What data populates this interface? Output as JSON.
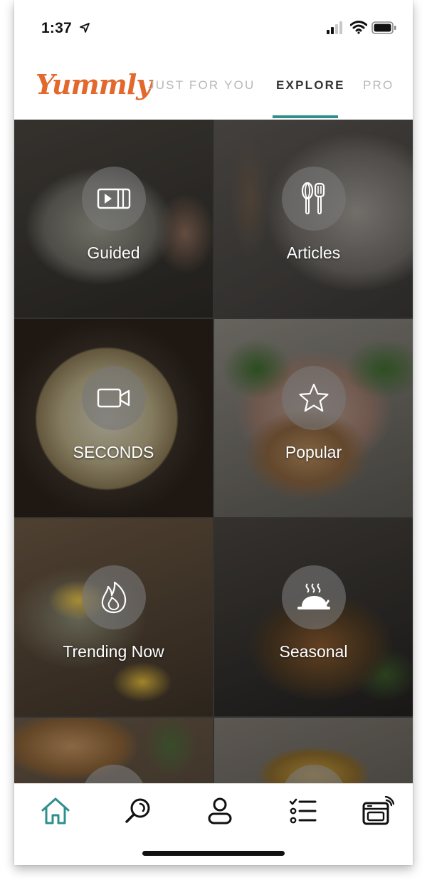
{
  "status_bar": {
    "time": "1:37"
  },
  "header": {
    "logo": "Yummly",
    "tabs": [
      {
        "label": "JUST FOR YOU",
        "active": false
      },
      {
        "label": "EXPLORE",
        "active": true
      },
      {
        "label": "PRO",
        "active": false
      }
    ],
    "accent_color": "#2f8f8c",
    "logo_color": "#e2682c"
  },
  "tiles": [
    {
      "label": "Guided",
      "icon": "video-guide-icon"
    },
    {
      "label": "Articles",
      "icon": "whisk-spatula-icon"
    },
    {
      "label": "SECONDS",
      "icon": "video-camera-icon"
    },
    {
      "label": "Popular",
      "icon": "star-icon"
    },
    {
      "label": "Trending Now",
      "icon": "flame-icon"
    },
    {
      "label": "Seasonal",
      "icon": "roast-dish-icon"
    }
  ],
  "bottom_nav": {
    "items": [
      {
        "name": "home",
        "icon": "home-icon",
        "active": true
      },
      {
        "name": "search",
        "icon": "search-icon",
        "active": false
      },
      {
        "name": "profile",
        "icon": "user-icon",
        "active": false
      },
      {
        "name": "shopping-list",
        "icon": "checklist-icon",
        "active": false
      },
      {
        "name": "smart-oven",
        "icon": "oven-icon",
        "active": false
      }
    ],
    "active_color": "#2f8f8c"
  }
}
